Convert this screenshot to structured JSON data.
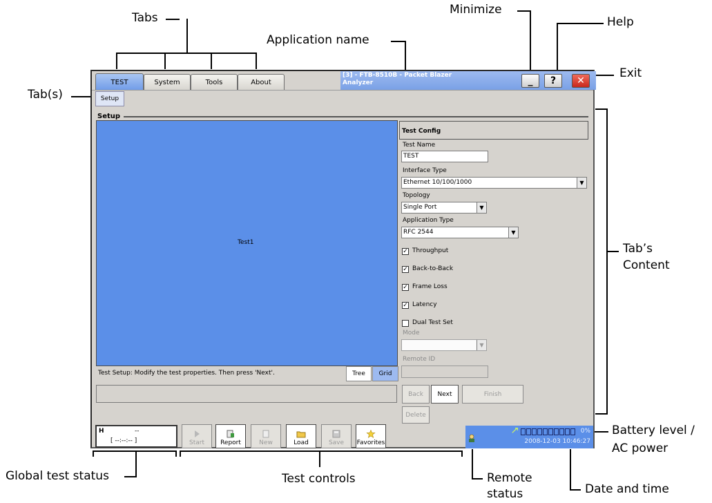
{
  "annotations": {
    "tabs": "Tabs",
    "application_name": "Application name",
    "minimize": "Minimize",
    "help": "Help",
    "exit": "Exit",
    "tab_s": "Tab(s)",
    "tabs_content_line1": "Tab’s",
    "tabs_content_line2": "Content",
    "battery_line1": "Battery level /",
    "battery_line2": "AC power",
    "global_test_status": "Global test status",
    "test_controls": "Test controls",
    "remote_status_line1": "Remote",
    "remote_status_line2": "status",
    "date_time": "Date and time"
  },
  "app": {
    "title_line1": "[3] - FTB-8510B - Packet Blazer",
    "title_line2": "Analyzer",
    "tabs": [
      {
        "label": "TEST",
        "active": true
      },
      {
        "label": "System",
        "active": false
      },
      {
        "label": "Tools",
        "active": false
      },
      {
        "label": "About",
        "active": false
      }
    ],
    "subtab": "Setup",
    "minimize_glyph": "_",
    "help_glyph": "?",
    "exit_glyph": "✕",
    "section_title": "Setup"
  },
  "canvas": {
    "node_label": "Test1",
    "status_text": "Test Setup: Modify the test properties. Then press 'Next'.",
    "view_tree": "Tree",
    "view_grid": "Grid",
    "color": "#5b8fe8"
  },
  "test_config": {
    "header": "Test Config",
    "test_name_label": "Test Name",
    "test_name_value": "TEST",
    "interface_type_label": "Interface Type",
    "interface_type_value": "Ethernet 10/100/1000",
    "topology_label": "Topology",
    "topology_value": "Single Port",
    "application_type_label": "Application Type",
    "application_type_value": "RFC 2544",
    "checkboxes": [
      {
        "label": "Throughput",
        "checked": true
      },
      {
        "label": "Back-to-Back",
        "checked": true
      },
      {
        "label": "Frame Loss",
        "checked": true
      },
      {
        "label": "Latency",
        "checked": true
      },
      {
        "label": "Dual Test Set",
        "checked": false
      }
    ],
    "mode_label": "Mode",
    "mode_value": "",
    "remote_id_label": "Remote ID",
    "remote_id_value": ""
  },
  "wizard": {
    "back": "Back",
    "next": "Next",
    "finish": "Finish",
    "delete": "Delete"
  },
  "global_status": {
    "h_label": "H",
    "top_value": "--",
    "timer": "[   --:--:--  ]"
  },
  "test_controls": {
    "start": "Start",
    "report": "Report",
    "new": "New",
    "load": "Load",
    "save": "Save",
    "favorites": "Favorites"
  },
  "status_bar": {
    "battery_percent": "0%",
    "datetime": "2008-12-03 10:46:27",
    "color": "#5b8fe8"
  }
}
